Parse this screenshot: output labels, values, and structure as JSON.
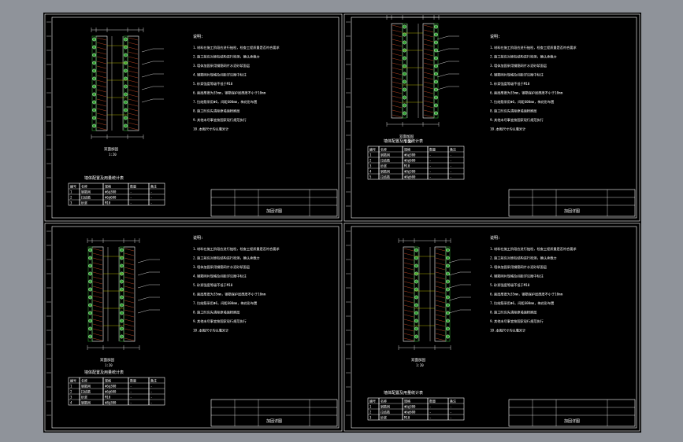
{
  "window": {
    "background": "#8f939a",
    "canvas_color": "#000000"
  },
  "sheets": [
    {
      "notes_title": "说明:",
      "notes": [
        "1.材料在施工阶段应进行抽检，检查工程质量是否符合要求",
        "2.施工前应对原有结构进行检测，确认承载力",
        "3.墙体加固采用钢筋网片水泥砂浆面层",
        "4.钢筋网片规格及间距详见图中标注",
        "5.砂浆强度等级不低于M10",
        "6.面层厚度为35mm，钢筋保护层厚度不小于10mm",
        "7.拉结筋采用Φ6，间距600mm，梅花形布置",
        "8.施工时应先清除原墙面粉刷层",
        "9.其他未尽事宜按国家现行规范执行",
        "10.本图尺寸均以毫米计"
      ],
      "table_title": "墙体配置及用量统计表",
      "table_headers": [
        "编号",
        "名称",
        "规格",
        "数量",
        "备注"
      ],
      "table_rows": [
        [
          "1",
          "钢筋网",
          "Φ6@300",
          "-",
          "-"
        ],
        [
          "2",
          "拉结筋",
          "Φ6@600",
          "-",
          "-"
        ],
        [
          "3",
          "砂浆",
          "M10",
          "-",
          "-"
        ]
      ],
      "section_label": "双面加固",
      "scale_label": "1:20",
      "title_block_label": "加固详图"
    },
    {
      "notes_title": "说明:",
      "notes": [
        "1.材料在施工阶段应进行抽检，检查工程质量是否符合要求",
        "2.施工前应对原有结构进行检测，确认承载力",
        "3.墙体加固采用钢筋网片水泥砂浆面层",
        "4.钢筋网片规格及间距详见图中标注",
        "5.砂浆强度等级不低于M10",
        "6.面层厚度为35mm，钢筋保护层厚度不小于10mm",
        "7.拉结筋采用Φ6，间距600mm，梅花形布置",
        "8.施工时应先清除原墙面粉刷层",
        "9.其他未尽事宜按国家现行规范执行",
        "10.本图尺寸均以毫米计"
      ],
      "table_title": "墙体配置及用量统计表",
      "table_headers": [
        "编号",
        "名称",
        "规格",
        "数量",
        "备注"
      ],
      "table_rows": [
        [
          "1",
          "钢筋网",
          "Φ6@300",
          "-",
          "-"
        ],
        [
          "2",
          "拉结筋",
          "Φ6@600",
          "-",
          "-"
        ],
        [
          "3",
          "砂浆",
          "M10",
          "-",
          "-"
        ],
        [
          "4",
          "钢筋网",
          "Φ8@300",
          "-",
          "-"
        ],
        [
          "5",
          "拉结筋",
          "Φ8@600",
          "-",
          "-"
        ]
      ],
      "section_label": "双面加固",
      "scale_label": "1:20",
      "title_block_label": "加固详图"
    },
    {
      "notes_title": "说明:",
      "notes": [
        "1.材料在施工阶段应进行抽检，检查工程质量是否符合要求",
        "2.施工前应对原有结构进行检测，确认承载力",
        "3.墙体加固采用钢筋网片水泥砂浆面层",
        "4.钢筋网片规格及间距详见图中标注",
        "5.砂浆强度等级不低于M10",
        "6.面层厚度为35mm，钢筋保护层厚度不小于10mm",
        "7.拉结筋采用Φ6，间距600mm，梅花形布置",
        "8.施工时应先清除原墙面粉刷层",
        "9.其他未尽事宜按国家现行规范执行",
        "10.本图尺寸均以毫米计"
      ],
      "table_title": "墙体配置及用量统计表",
      "table_headers": [
        "编号",
        "名称",
        "规格",
        "数量",
        "备注"
      ],
      "table_rows": [
        [
          "1",
          "钢筋网",
          "Φ6@300",
          "-",
          "-"
        ],
        [
          "2",
          "拉结筋",
          "Φ6@600",
          "-",
          "-"
        ],
        [
          "3",
          "砂浆",
          "M10",
          "-",
          "-"
        ],
        [
          "4",
          "钢筋网",
          "Φ8@300",
          "-",
          "-"
        ]
      ],
      "section_label": "双面加固",
      "scale_label": "1:20",
      "title_block_label": "加固详图"
    },
    {
      "notes_title": "说明:",
      "notes": [
        "1.材料在施工阶段应进行抽检，检查工程质量是否符合要求",
        "2.施工前应对原有结构进行检测，确认承载力",
        "3.墙体加固采用钢筋网片水泥砂浆面层",
        "4.钢筋网片规格及间距详见图中标注",
        "5.砂浆强度等级不低于M10",
        "6.面层厚度为35mm，钢筋保护层厚度不小于10mm",
        "7.拉结筋采用Φ6，间距600mm，梅花形布置",
        "8.施工时应先清除原墙面粉刷层",
        "9.其他未尽事宜按国家现行规范执行",
        "10.本图尺寸均以毫米计"
      ],
      "table_title": "墙体配置及用量统计表",
      "table_headers": [
        "编号",
        "名称",
        "规格",
        "数量",
        "备注"
      ],
      "table_rows": [
        [
          "1",
          "钢筋网",
          "Φ6@300",
          "-",
          "-"
        ],
        [
          "2",
          "拉结筋",
          "Φ6@600",
          "-",
          "-"
        ],
        [
          "3",
          "砂浆",
          "M10",
          "-",
          "-"
        ]
      ],
      "section_label": "双面加固",
      "scale_label": "1:20",
      "title_block_label": "加固详图"
    }
  ],
  "colors": {
    "line": "#ffffff",
    "brick": "#b3421f",
    "mesh": "#2fa12f",
    "accent": "#d6d000"
  }
}
